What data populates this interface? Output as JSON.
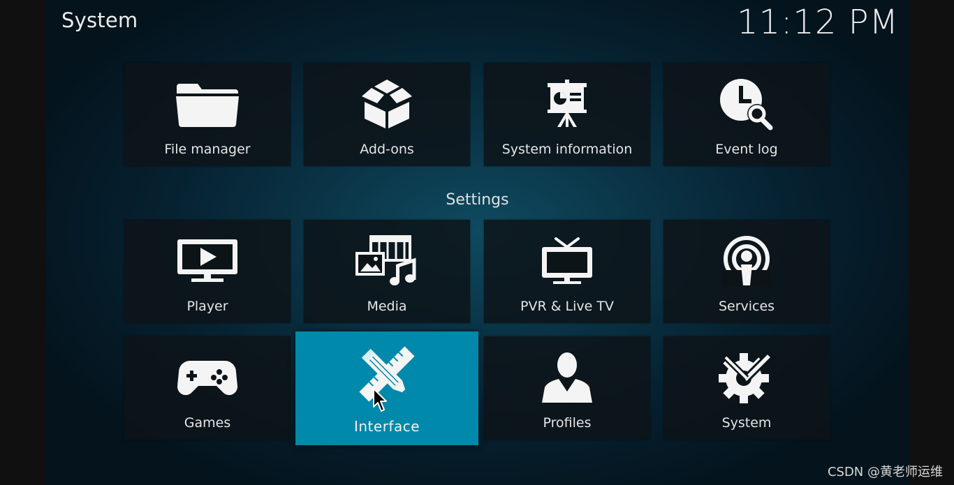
{
  "header": {
    "title": "System",
    "clock": "11:12 PM"
  },
  "sections": {
    "top": [
      {
        "label": "File manager",
        "icon": "folder-icon"
      },
      {
        "label": "Add-ons",
        "icon": "box-icon"
      },
      {
        "label": "System information",
        "icon": "presentation-chart-icon"
      },
      {
        "label": "Event log",
        "icon": "clock-search-icon"
      }
    ],
    "settings_label": "Settings",
    "settings": [
      {
        "label": "Player",
        "icon": "monitor-play-icon"
      },
      {
        "label": "Media",
        "icon": "media-library-icon"
      },
      {
        "label": "PVR & Live TV",
        "icon": "tv-antenna-icon"
      },
      {
        "label": "Services",
        "icon": "broadcast-icon"
      },
      {
        "label": "Games",
        "icon": "gamepad-icon"
      },
      {
        "label": "Interface",
        "icon": "pencil-ruler-icon",
        "focused": true
      },
      {
        "label": "Profiles",
        "icon": "user-profile-icon"
      },
      {
        "label": "System",
        "icon": "gear-tools-icon"
      }
    ]
  },
  "watermark": "CSDN @黄老师运维",
  "colors": {
    "focus": "#0089aa",
    "background": "#0a3446",
    "tile": "#0d1418"
  }
}
